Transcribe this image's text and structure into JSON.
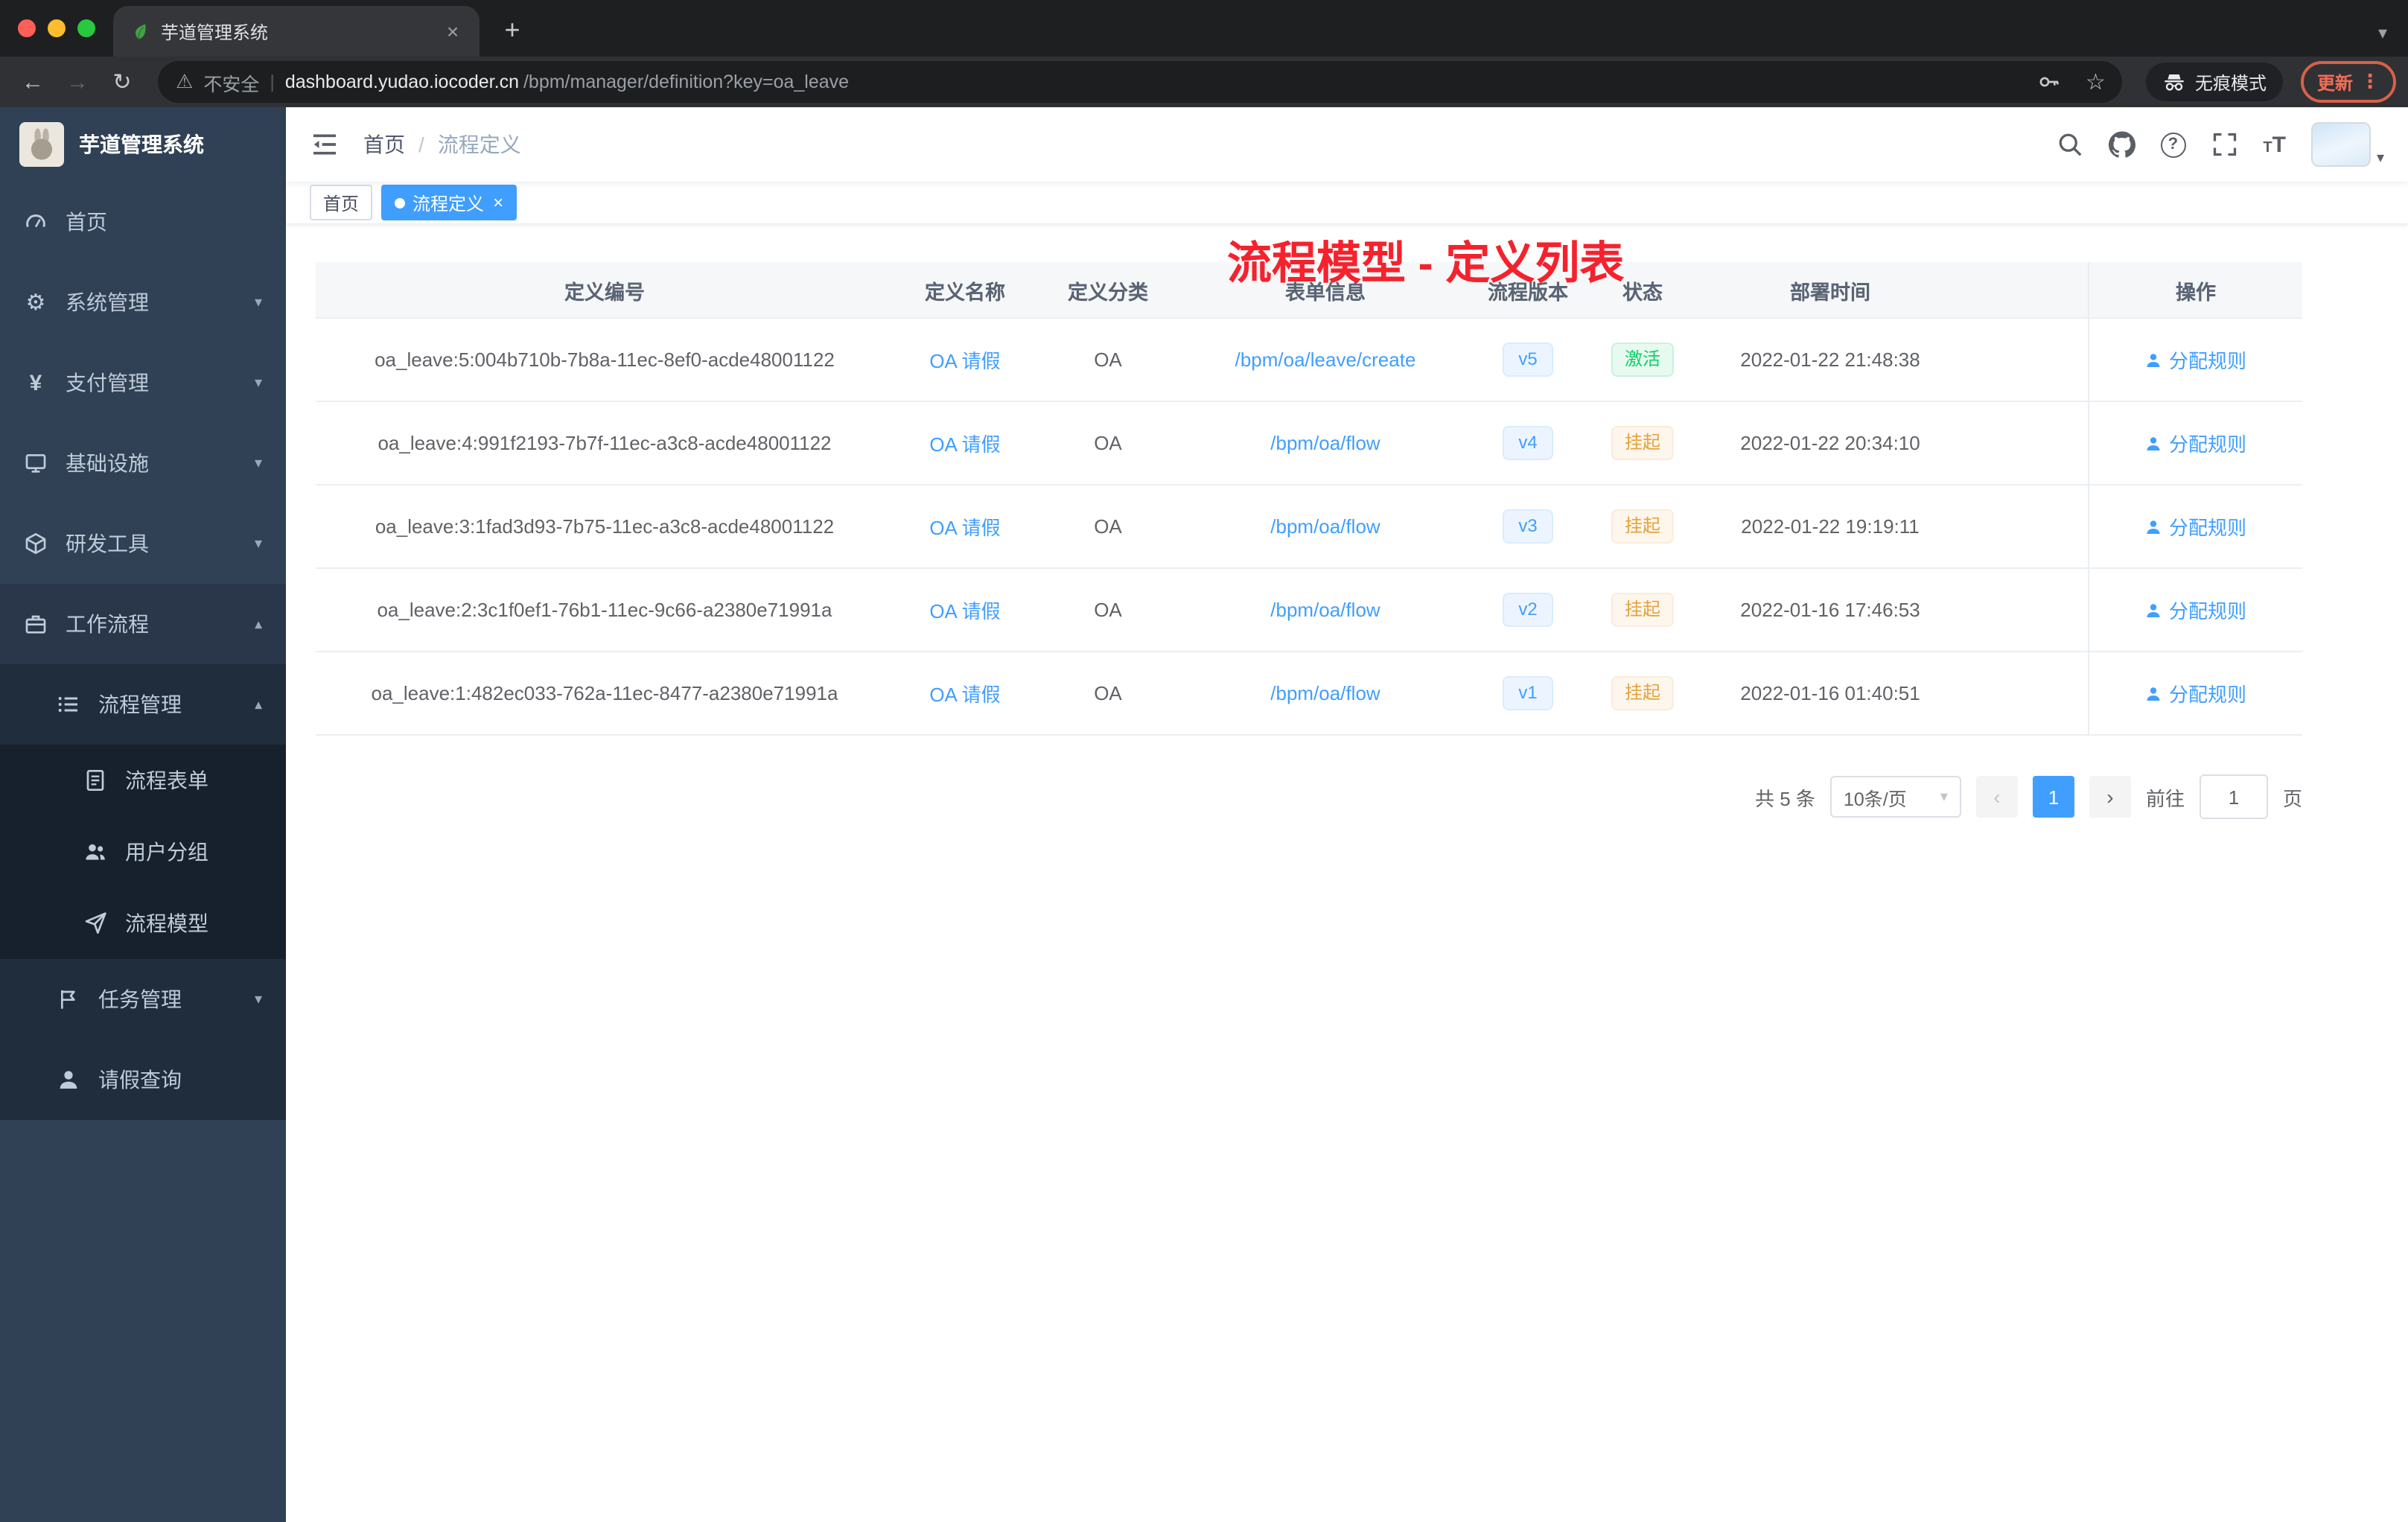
{
  "browser": {
    "tab_title": "芋道管理系统",
    "security_label": "不安全",
    "url_host": "dashboard.yudao.iocoder.cn",
    "url_path": "/bpm/manager/definition?key=oa_leave",
    "incognito_label": "无痕模式",
    "update_label": "更新"
  },
  "icons": {
    "back": "←",
    "forward": "→",
    "reload": "↻",
    "warning": "⚠",
    "divider": "|",
    "star": "☆",
    "dots": "⋮",
    "plus": "+",
    "close": "×",
    "chevron_down": "▾",
    "gear": "⚙",
    "yen": "¥",
    "question": "?",
    "font_size": "T",
    "prev": "‹",
    "next": "›"
  },
  "sidebar": {
    "logo_title": "芋道管理系统",
    "items": [
      {
        "label": "首页"
      },
      {
        "label": "系统管理"
      },
      {
        "label": "支付管理"
      },
      {
        "label": "基础设施"
      },
      {
        "label": "研发工具"
      },
      {
        "label": "工作流程"
      },
      {
        "label": "流程管理"
      },
      {
        "label": "流程表单"
      },
      {
        "label": "用户分组"
      },
      {
        "label": "流程模型"
      },
      {
        "label": "任务管理"
      },
      {
        "label": "请假查询"
      }
    ]
  },
  "header": {
    "breadcrumb_home": "首页",
    "breadcrumb_separator": "/",
    "breadcrumb_current": "流程定义",
    "annotation": "流程模型 - 定义列表"
  },
  "tags": {
    "home": "首页",
    "active": "流程定义"
  },
  "table": {
    "columns": [
      "定义编号",
      "定义名称",
      "定义分类",
      "表单信息",
      "流程版本",
      "状态",
      "部署时间",
      "操作"
    ],
    "rows": [
      {
        "id": "oa_leave:5:004b710b-7b8a-11ec-8ef0-acde48001122",
        "name": "OA 请假",
        "category": "OA",
        "form": "/bpm/oa/leave/create",
        "version": "v5",
        "status": "激活",
        "time": "2022-01-22 21:48:38",
        "action": "分配规则"
      },
      {
        "id": "oa_leave:4:991f2193-7b7f-11ec-a3c8-acde48001122",
        "name": "OA 请假",
        "category": "OA",
        "form": "/bpm/oa/flow",
        "version": "v4",
        "status": "挂起",
        "time": "2022-01-22 20:34:10",
        "action": "分配规则"
      },
      {
        "id": "oa_leave:3:1fad3d93-7b75-11ec-a3c8-acde48001122",
        "name": "OA 请假",
        "category": "OA",
        "form": "/bpm/oa/flow",
        "version": "v3",
        "status": "挂起",
        "time": "2022-01-22 19:19:11",
        "action": "分配规则"
      },
      {
        "id": "oa_leave:2:3c1f0ef1-76b1-11ec-9c66-a2380e71991a",
        "name": "OA 请假",
        "category": "OA",
        "form": "/bpm/oa/flow",
        "version": "v2",
        "status": "挂起",
        "time": "2022-01-16 17:46:53",
        "action": "分配规则"
      },
      {
        "id": "oa_leave:1:482ec033-762a-11ec-8477-a2380e71991a",
        "name": "OA 请假",
        "category": "OA",
        "form": "/bpm/oa/flow",
        "version": "v1",
        "status": "挂起",
        "time": "2022-01-16 01:40:51",
        "action": "分配规则"
      }
    ]
  },
  "pagination": {
    "total": "共 5 条",
    "page_size": "10条/页",
    "current_page": "1",
    "goto_label": "前往",
    "goto_value": "1",
    "page_unit": "页"
  },
  "colors": {
    "accent": "#409eff",
    "success_green": "#13ce66",
    "warning_orange": "#e6a23c",
    "annotation_red": "#f5222d",
    "sidebar_bg": "#304156"
  }
}
